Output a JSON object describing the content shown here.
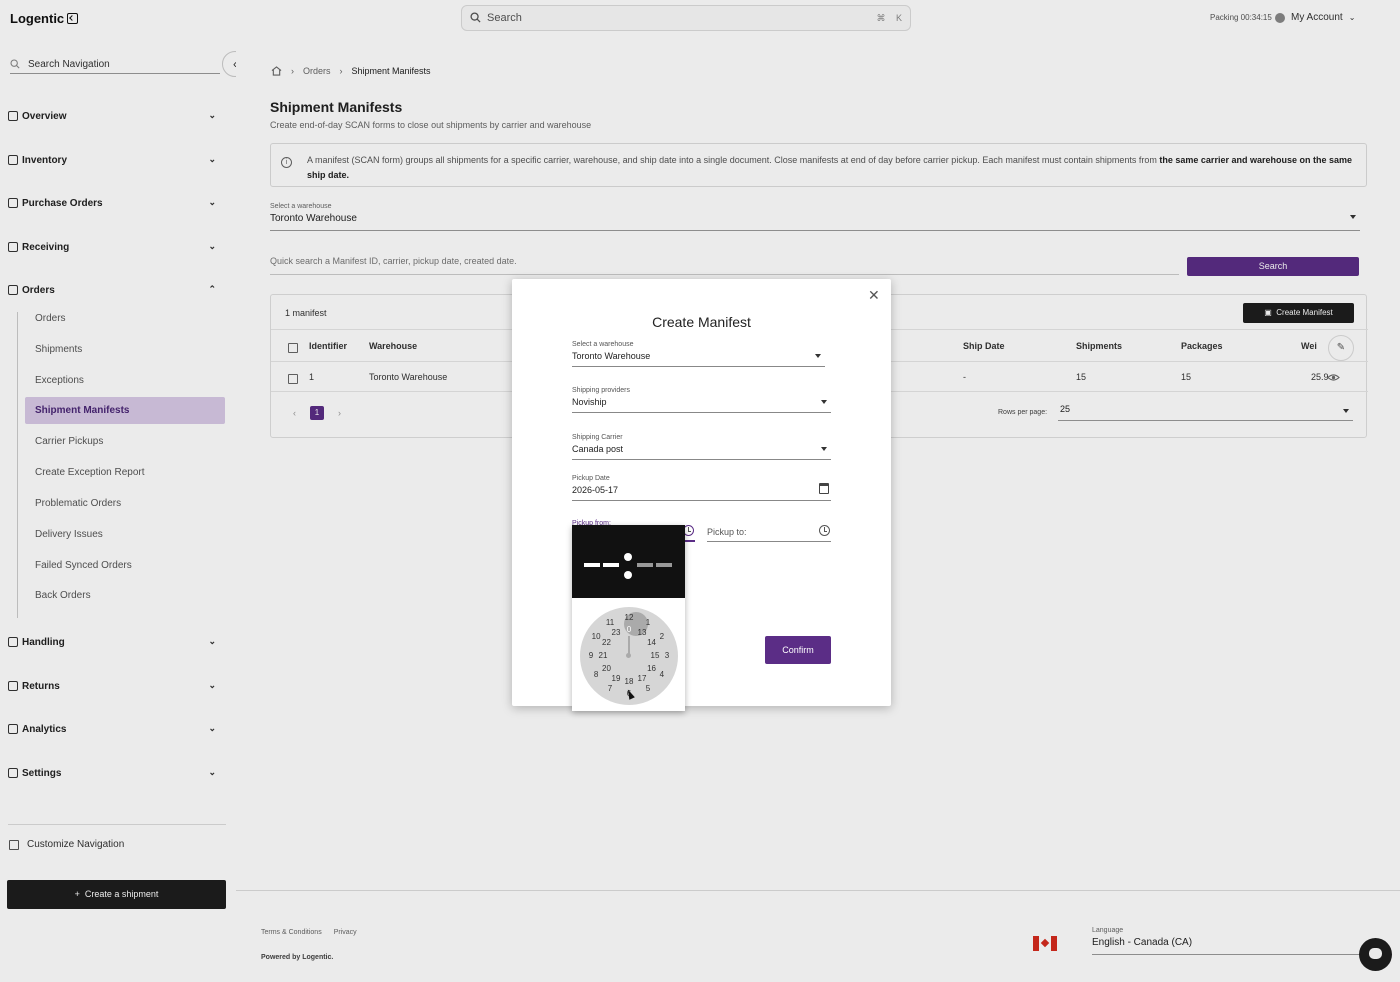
{
  "app": {
    "logo": "Logentic",
    "search_placeholder": "Search",
    "kbd": [
      "⌘",
      "K"
    ],
    "packing_text": "Packing 00:34:15",
    "account_label": "My Account"
  },
  "sidebar": {
    "search_placeholder": "Search Navigation",
    "groups": [
      {
        "label": "Overview"
      },
      {
        "label": "Inventory"
      },
      {
        "label": "Purchase Orders"
      },
      {
        "label": "Receiving"
      },
      {
        "label": "Orders"
      },
      {
        "label": "Handling"
      },
      {
        "label": "Returns"
      },
      {
        "label": "Analytics"
      },
      {
        "label": "Settings"
      }
    ],
    "order_items": [
      {
        "label": "Orders"
      },
      {
        "label": "Shipments"
      },
      {
        "label": "Exceptions"
      },
      {
        "label": "Shipment Manifests"
      },
      {
        "label": "Carrier Pickups"
      },
      {
        "label": "Create Exception Report"
      },
      {
        "label": "Problematic Orders"
      },
      {
        "label": "Delivery Issues"
      },
      {
        "label": "Failed Synced Orders"
      },
      {
        "label": "Back Orders"
      }
    ],
    "customize_label": "Customize Navigation",
    "create_shipment_label": "Create a shipment"
  },
  "breadcrumb": [
    "Orders",
    "Shipment Manifests"
  ],
  "page": {
    "title": "Shipment Manifests",
    "subtitle": "Create end-of-day SCAN forms to close out shipments by carrier and warehouse",
    "info_text": "A manifest (SCAN form) groups all shipments for a specific carrier, warehouse, and ship date into a single document. Close manifests at end of day before carrier pickup. Each manifest must contain shipments from ",
    "info_bold": "the same carrier and warehouse on the same ship date.",
    "warehouse_label": "Select a warehouse",
    "warehouse_value": "Toronto Warehouse",
    "quick_search_placeholder": "Quick search a Manifest ID, carrier, pickup date, created date.",
    "search_button": "Search",
    "manifest_count": "1 manifest",
    "create_manifest_button": "Create Manifest",
    "table": {
      "headers": [
        "Identifier",
        "Warehouse",
        "Ship Date",
        "Shipments",
        "Packages",
        "Wei"
      ],
      "rows": [
        {
          "identifier": "1",
          "warehouse": "Toronto Warehouse",
          "ship_date": "-",
          "shipments": "15",
          "packages": "15",
          "weight": "25.9"
        }
      ]
    },
    "current_page": "1",
    "rows_per_page_label": "Rows per page:",
    "rows_per_page_value": "25"
  },
  "footer": {
    "links": [
      "Terms & Conditions",
      "Privacy"
    ],
    "powered": "Powered by Logentic.",
    "language_label": "Language",
    "language_value": "English - Canada (CA)"
  },
  "modal": {
    "title": "Create Manifest",
    "warehouse_label": "Select a warehouse",
    "warehouse_value": "Toronto Warehouse",
    "provider_label": "Shipping providers",
    "provider_value": "Noviship",
    "carrier_label": "Shipping Carrier",
    "carrier_value": "Canada post",
    "pickup_date_label": "Pickup Date",
    "pickup_date_value": "2026-05-17",
    "pickup_from_label": "Pickup from:",
    "pickup_to_placeholder": "Pickup to:",
    "confirm_button": "Confirm"
  },
  "time_picker": {
    "selected_hour": "0",
    "outer_hours": [
      "12",
      "1",
      "2",
      "3",
      "4",
      "5",
      "6",
      "7",
      "8",
      "9",
      "10",
      "11"
    ],
    "inner_hours": [
      "0",
      "13",
      "14",
      "15",
      "16",
      "17",
      "18",
      "19",
      "20",
      "21",
      "22",
      "23"
    ]
  },
  "colors": {
    "accent": "#5b2d86",
    "active_nav_bg": "#d8c9e6",
    "dark_button": "#1e1e1e"
  }
}
